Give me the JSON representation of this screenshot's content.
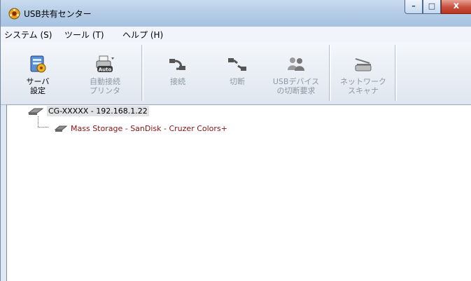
{
  "window": {
    "title": "USB共有センター",
    "app_icon": "gear-cluster-icon"
  },
  "title_controls": {
    "minimize": "–",
    "maximize": "□",
    "close": "x"
  },
  "menu": [
    {
      "label": "システム (S)"
    },
    {
      "label": "ツール (T)"
    },
    {
      "label": "ヘルプ (H)"
    }
  ],
  "toolbar": {
    "server_settings": {
      "label": "サーバ\n設定",
      "icon": "server-settings-icon",
      "enabled": true
    },
    "auto_connect_printer": {
      "label": "自動接続\nプリンタ",
      "icon": "printer-auto-icon",
      "badge": "Auto",
      "enabled": false
    },
    "connect": {
      "label": "接続",
      "icon": "plug-connect-icon",
      "enabled": false
    },
    "disconnect": {
      "label": "切断",
      "icon": "plug-disconnect-icon",
      "enabled": false
    },
    "usb_disconnect_request": {
      "label": "USBデバイス\nの切断要求",
      "icon": "users-request-icon",
      "enabled": false
    },
    "network_scanner": {
      "label": "ネットワーク\nスキャナ",
      "icon": "scanner-icon",
      "enabled": false
    }
  },
  "tree": {
    "root": {
      "label": "CG-XXXXX - 192.168.1.22",
      "icon": "server-device-icon"
    },
    "children": [
      {
        "label": "Mass Storage - SanDisk - Cruzer Colors+",
        "icon": "usb-storage-icon"
      }
    ]
  },
  "colors": {
    "disabled_text": "#8d97a3",
    "device_text": "#8a1010",
    "selection_bg": "#e1e3e6"
  }
}
